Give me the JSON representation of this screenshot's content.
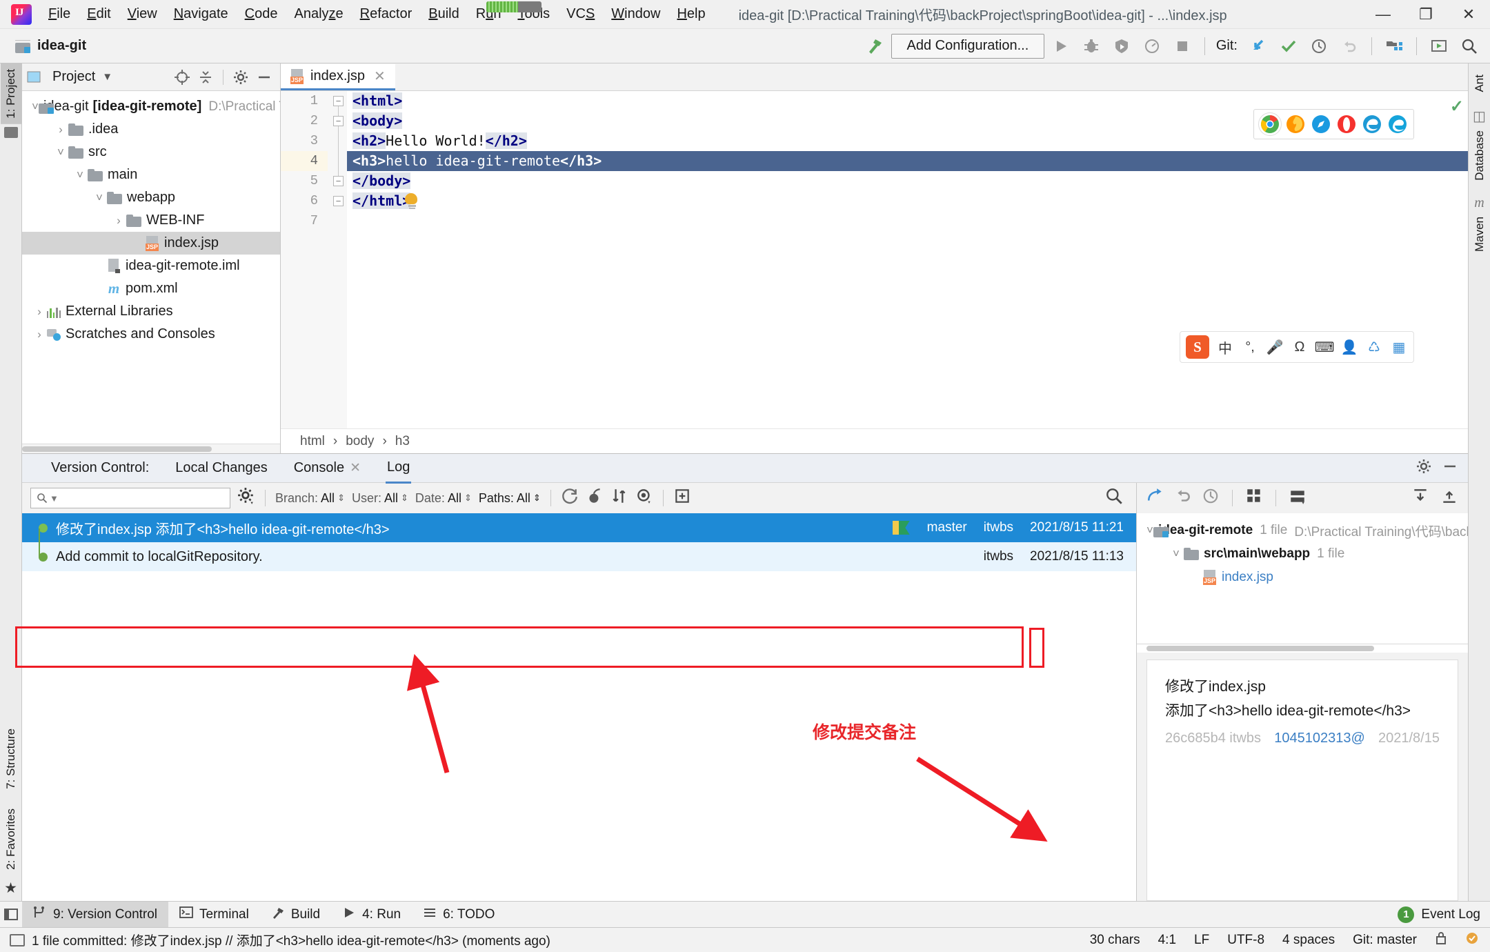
{
  "window": {
    "title": "idea-git [D:\\Practical Training\\代码\\backProject\\springBoot\\idea-git] - ...\\index.jsp",
    "minimize": "—",
    "maximize": "❐",
    "close": "✕"
  },
  "menu": [
    {
      "label": "File",
      "mnemonic": "F"
    },
    {
      "label": "Edit",
      "mnemonic": "E"
    },
    {
      "label": "View",
      "mnemonic": "V"
    },
    {
      "label": "Navigate",
      "mnemonic": "N"
    },
    {
      "label": "Code",
      "mnemonic": "C"
    },
    {
      "label": "Analyze",
      "mnemonic": "z"
    },
    {
      "label": "Refactor",
      "mnemonic": "R"
    },
    {
      "label": "Build",
      "mnemonic": "B"
    },
    {
      "label": "Run",
      "mnemonic": "u"
    },
    {
      "label": "Tools",
      "mnemonic": "T"
    },
    {
      "label": "VCS",
      "mnemonic": "S"
    },
    {
      "label": "Window",
      "mnemonic": "W"
    },
    {
      "label": "Help",
      "mnemonic": "H"
    }
  ],
  "toolbar": {
    "project_name": "idea-git",
    "add_configuration": "Add Configuration...",
    "git_label": "Git:",
    "icons": [
      "build-hammer-icon",
      "run-icon",
      "debug-icon",
      "run-coverage-icon",
      "profile-icon",
      "stop-icon",
      "git-update-icon",
      "git-commit-icon",
      "git-history-icon",
      "git-rollback-icon",
      "project-structure-icon",
      "presentation-icon",
      "search-everywhere-icon"
    ]
  },
  "rail_left": {
    "project_tab": "1: Project",
    "favorites_tab": "2: Favorites",
    "structure_tab": "7: Structure"
  },
  "rail_right": {
    "ant_tab": "Ant",
    "database_tab": "Database",
    "maven_tab": "Maven"
  },
  "project_panel": {
    "title": "Project",
    "icons": [
      "locate-icon",
      "collapse-all-icon",
      "settings-gear-icon",
      "hide-icon"
    ],
    "tree": [
      {
        "label": "idea-git",
        "suffix": "[idea-git-remote]",
        "path": "D:\\Practical Trai",
        "depth": 0,
        "icon": "folder-vcs-icon",
        "expanded": true,
        "bold": true
      },
      {
        "label": ".idea",
        "depth": 1,
        "icon": "folder-icon",
        "expanded": false
      },
      {
        "label": "src",
        "depth": 1,
        "icon": "folder-icon",
        "expanded": true
      },
      {
        "label": "main",
        "depth": 2,
        "icon": "folder-icon",
        "expanded": true
      },
      {
        "label": "webapp",
        "depth": 3,
        "icon": "folder-icon",
        "expanded": true
      },
      {
        "label": "WEB-INF",
        "depth": 4,
        "icon": "folder-icon",
        "expanded": false
      },
      {
        "label": "index.jsp",
        "depth": 4,
        "icon": "jsp-file-icon",
        "selected": true
      },
      {
        "label": "idea-git-remote.iml",
        "depth": 2,
        "icon": "iml-file-icon"
      },
      {
        "label": "pom.xml",
        "depth": 2,
        "icon": "maven-file-icon"
      },
      {
        "label": "External Libraries",
        "depth": 0,
        "icon": "libraries-icon",
        "expanded": false
      },
      {
        "label": "Scratches and Consoles",
        "depth": 0,
        "icon": "scratches-icon",
        "expanded": false
      }
    ]
  },
  "editor": {
    "tab_label": "index.jsp",
    "tab_close": "✕",
    "lines": [
      {
        "num": "1",
        "text": "<html>",
        "fold": true,
        "kind": "tag"
      },
      {
        "num": "2",
        "text": "<body>",
        "fold": true,
        "kind": "tag"
      },
      {
        "num": "3",
        "text": "<h2>Hello World!</h2>",
        "kind": "mixed"
      },
      {
        "num": "4",
        "text": "<h3>hello idea-git-remote</h3>",
        "kind": "selected"
      },
      {
        "num": "5",
        "text": "</body>",
        "fold": true,
        "kind": "tag"
      },
      {
        "num": "6",
        "text": "</html>",
        "fold": true,
        "kind": "tag"
      },
      {
        "num": "7",
        "text": "",
        "kind": "empty"
      }
    ],
    "breadcrumb": [
      "html",
      "body",
      "h3"
    ],
    "breadcrumb_sep": "›",
    "browsers": [
      "chrome-icon",
      "firefox-icon",
      "safari-icon",
      "opera-icon",
      "edge-legacy-icon",
      "edge-icon"
    ],
    "ime": [
      "sogou-icon",
      "chinese-mode-icon",
      "punctuation-icon",
      "voice-icon",
      "symbol-icon",
      "keyboard-icon",
      "user-icon",
      "bowtie-icon",
      "apps-icon"
    ],
    "ime_chinese_label": "中",
    "ok_check": "✓"
  },
  "vcs": {
    "title": "Version Control:",
    "tabs": [
      {
        "label": "Local Changes",
        "active": false
      },
      {
        "label": "Console",
        "active": false,
        "closable": true
      },
      {
        "label": "Log",
        "active": true
      }
    ],
    "close_icon": "✕",
    "panel_icons": [
      "settings-gear-icon",
      "hide-window-icon"
    ],
    "log_toolbar": {
      "search_placeholder": "",
      "search_icon": "search-icon",
      "gear_icon": "gear-icon",
      "filters": [
        {
          "label": "Branch:",
          "value": "All"
        },
        {
          "label": "User:",
          "value": "All"
        },
        {
          "label": "Date:",
          "value": "All"
        },
        {
          "label": "Paths:",
          "value": "All",
          "bold": true
        }
      ],
      "actions": [
        "refresh-icon",
        "cherry-pick-icon",
        "sort-icon",
        "show-details-icon",
        "go-to-hash-icon",
        "search-icon"
      ]
    },
    "commits": [
      {
        "message": "修改了index.jsp 添加了<h3>hello idea-git-remote</h3>",
        "branch": "master",
        "author": "itwbs",
        "date": "2021/8/15 11:21",
        "selected": true,
        "has_tag": true
      },
      {
        "message": "Add commit to localGitRepository.",
        "branch": "",
        "author": "itwbs",
        "date": "2021/8/15 11:13",
        "selected": false,
        "has_tag": false
      }
    ],
    "changes_toolbar": [
      "jump-to-source-icon",
      "revert-icon",
      "history-icon",
      "group-by-directory-icon",
      "group-by-module-icon",
      "expand-all-icon",
      "collapse-all-icon"
    ],
    "changed_files": [
      {
        "label": "idea-git-remote",
        "count": "1 file",
        "path": "D:\\Practical Training\\代码\\backI",
        "depth": 0,
        "icon": "folder-vcs-icon",
        "bold": true
      },
      {
        "label": "src\\main\\webapp",
        "count": "1 file",
        "depth": 1,
        "icon": "folder-icon"
      },
      {
        "label": "index.jsp",
        "count": "",
        "depth": 2,
        "icon": "jsp-file-icon",
        "link": true
      }
    ],
    "detail": {
      "line1": "修改了index.jsp",
      "line2": "添加了<h3>hello idea-git-remote</h3>",
      "hash_line": "26c685b4 itwbs",
      "hash_link": "1045102313@",
      "hash_date": "2021/8/15"
    }
  },
  "annotation": {
    "label": "修改提交备注",
    "color": "#e8262a"
  },
  "tool_window_bar": {
    "items": [
      {
        "label": "9: Version Control",
        "icon": "vcs-icon",
        "active": true
      },
      {
        "label": "Terminal",
        "icon": "terminal-icon",
        "active": false
      },
      {
        "label": "Build",
        "icon": "build-icon",
        "active": false
      },
      {
        "label": "4: Run",
        "icon": "run-icon",
        "active": false
      },
      {
        "label": "6: TODO",
        "icon": "todo-icon",
        "active": false
      }
    ],
    "event_log": "Event Log",
    "event_count": "1"
  },
  "statusbar": {
    "message": "1 file committed: 修改了index.jsp // 添加了<h3>hello idea-git-remote</h3> (moments ago)",
    "chars": "30 chars",
    "caret": "4:1",
    "line_sep": "LF",
    "encoding": "UTF-8",
    "indent": "4 spaces",
    "branch": "Git: master",
    "lock_icon": "lock-icon",
    "inspect_icon": "inspection-icon"
  }
}
